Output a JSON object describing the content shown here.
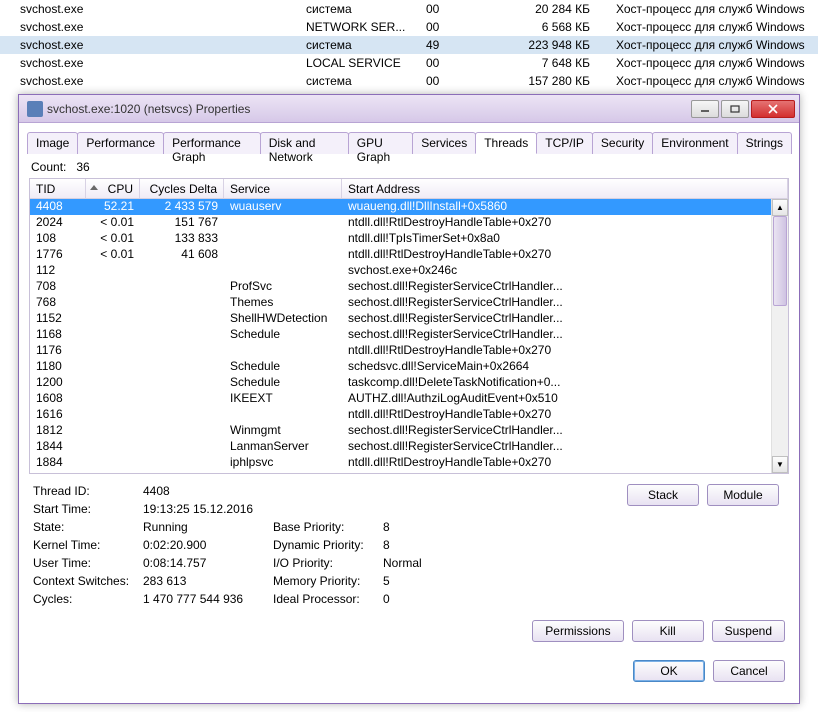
{
  "bg_rows": [
    {
      "name": "svchost.exe",
      "user": "система",
      "cpu": "00",
      "mem": "20 284 КБ",
      "desc": "Хост-процесс для служб Windows",
      "sel": false
    },
    {
      "name": "svchost.exe",
      "user": "NETWORK SER...",
      "cpu": "00",
      "mem": "6 568 КБ",
      "desc": "Хост-процесс для служб Windows",
      "sel": false
    },
    {
      "name": "svchost.exe",
      "user": "система",
      "cpu": "49",
      "mem": "223 948 КБ",
      "desc": "Хост-процесс для служб Windows",
      "sel": true
    },
    {
      "name": "svchost.exe",
      "user": "LOCAL SERVICE",
      "cpu": "00",
      "mem": "7 648 КБ",
      "desc": "Хост-процесс для служб Windows",
      "sel": false
    },
    {
      "name": "svchost.exe",
      "user": "система",
      "cpu": "00",
      "mem": "157 280 КБ",
      "desc": "Хост-процесс для служб Windows",
      "sel": false
    }
  ],
  "dialog": {
    "title": "svchost.exe:1020 (netsvcs) Properties"
  },
  "tabs": [
    "Image",
    "Performance",
    "Performance Graph",
    "Disk and Network",
    "GPU Graph",
    "Services",
    "Threads",
    "TCP/IP",
    "Security",
    "Environment",
    "Strings"
  ],
  "active_tab": 6,
  "count_label": "Count:",
  "count_value": "36",
  "headers": {
    "tid": "TID",
    "cpu": "CPU",
    "cyc": "Cycles Delta",
    "svc": "Service",
    "addr": "Start Address"
  },
  "threads": [
    {
      "tid": "4408",
      "cpu": "52.21",
      "cyc": "2 433 579",
      "svc": "wuauserv",
      "addr": "wuaueng.dll!DllInstall+0x5860",
      "sel": true
    },
    {
      "tid": "2024",
      "cpu": "< 0.01",
      "cyc": "151 767",
      "svc": "",
      "addr": "ntdll.dll!RtlDestroyHandleTable+0x270"
    },
    {
      "tid": "108",
      "cpu": "< 0.01",
      "cyc": "133 833",
      "svc": "",
      "addr": "ntdll.dll!TpIsTimerSet+0x8a0"
    },
    {
      "tid": "1776",
      "cpu": "< 0.01",
      "cyc": "41 608",
      "svc": "",
      "addr": "ntdll.dll!RtlDestroyHandleTable+0x270"
    },
    {
      "tid": "112",
      "cpu": "",
      "cyc": "",
      "svc": "",
      "addr": "svchost.exe+0x246c"
    },
    {
      "tid": "708",
      "cpu": "",
      "cyc": "",
      "svc": "ProfSvc",
      "addr": "sechost.dll!RegisterServiceCtrlHandler..."
    },
    {
      "tid": "768",
      "cpu": "",
      "cyc": "",
      "svc": "Themes",
      "addr": "sechost.dll!RegisterServiceCtrlHandler..."
    },
    {
      "tid": "1152",
      "cpu": "",
      "cyc": "",
      "svc": "ShellHWDetection",
      "addr": "sechost.dll!RegisterServiceCtrlHandler..."
    },
    {
      "tid": "1168",
      "cpu": "",
      "cyc": "",
      "svc": "Schedule",
      "addr": "sechost.dll!RegisterServiceCtrlHandler..."
    },
    {
      "tid": "1176",
      "cpu": "",
      "cyc": "",
      "svc": "",
      "addr": "ntdll.dll!RtlDestroyHandleTable+0x270"
    },
    {
      "tid": "1180",
      "cpu": "",
      "cyc": "",
      "svc": "Schedule",
      "addr": "schedsvc.dll!ServiceMain+0x2664"
    },
    {
      "tid": "1200",
      "cpu": "",
      "cyc": "",
      "svc": "Schedule",
      "addr": "taskcomp.dll!DeleteTaskNotification+0..."
    },
    {
      "tid": "1608",
      "cpu": "",
      "cyc": "",
      "svc": "IKEEXT",
      "addr": "AUTHZ.dll!AuthziLogAuditEvent+0x510"
    },
    {
      "tid": "1616",
      "cpu": "",
      "cyc": "",
      "svc": "",
      "addr": "ntdll.dll!RtlDestroyHandleTable+0x270"
    },
    {
      "tid": "1812",
      "cpu": "",
      "cyc": "",
      "svc": "Winmgmt",
      "addr": "sechost.dll!RegisterServiceCtrlHandler..."
    },
    {
      "tid": "1844",
      "cpu": "",
      "cyc": "",
      "svc": "LanmanServer",
      "addr": "sechost.dll!RegisterServiceCtrlHandler..."
    },
    {
      "tid": "1884",
      "cpu": "",
      "cyc": "",
      "svc": "iphlpsvc",
      "addr": "ntdll.dll!RtlDestroyHandleTable+0x270"
    }
  ],
  "details": {
    "thread_id_lab": "Thread ID:",
    "thread_id": "4408",
    "start_time_lab": "Start Time:",
    "start_time": "19:13:25   15.12.2016",
    "state_lab": "State:",
    "state": "Running",
    "kernel_lab": "Kernel Time:",
    "kernel": "0:02:20.900",
    "user_lab": "User Time:",
    "user": "0:08:14.757",
    "ctx_lab": "Context Switches:",
    "ctx": "283 613",
    "cycles_lab": "Cycles:",
    "cycles": "1 470 777 544 936",
    "base_lab": "Base Priority:",
    "base": "8",
    "dyn_lab": "Dynamic Priority:",
    "dyn": "8",
    "io_lab": "I/O Priority:",
    "io": "Normal",
    "mem_lab": "Memory Priority:",
    "mem": "5",
    "ideal_lab": "Ideal Processor:",
    "ideal": "0"
  },
  "buttons": {
    "stack": "Stack",
    "module": "Module",
    "permissions": "Permissions",
    "kill": "Kill",
    "suspend": "Suspend",
    "ok": "OK",
    "cancel": "Cancel"
  }
}
